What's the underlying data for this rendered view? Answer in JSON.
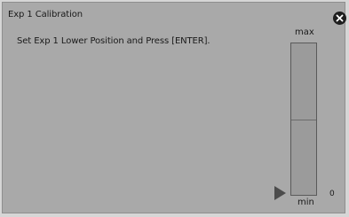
{
  "dialog": {
    "title": "Exp 1 Calibration",
    "message": "Set Exp 1 Lower Position and Press [ENTER].",
    "close_icon": "close-circle-icon"
  },
  "gauge": {
    "max_label": "max",
    "min_label": "min",
    "zero_label": "0",
    "level_fraction": 0.0,
    "midline_fraction": 0.5,
    "pointer_icon": "triangle-right-icon"
  },
  "colors": {
    "background": "#a9a9a9",
    "text": "#1a1a1a",
    "close_button": "#1e1e1e"
  }
}
